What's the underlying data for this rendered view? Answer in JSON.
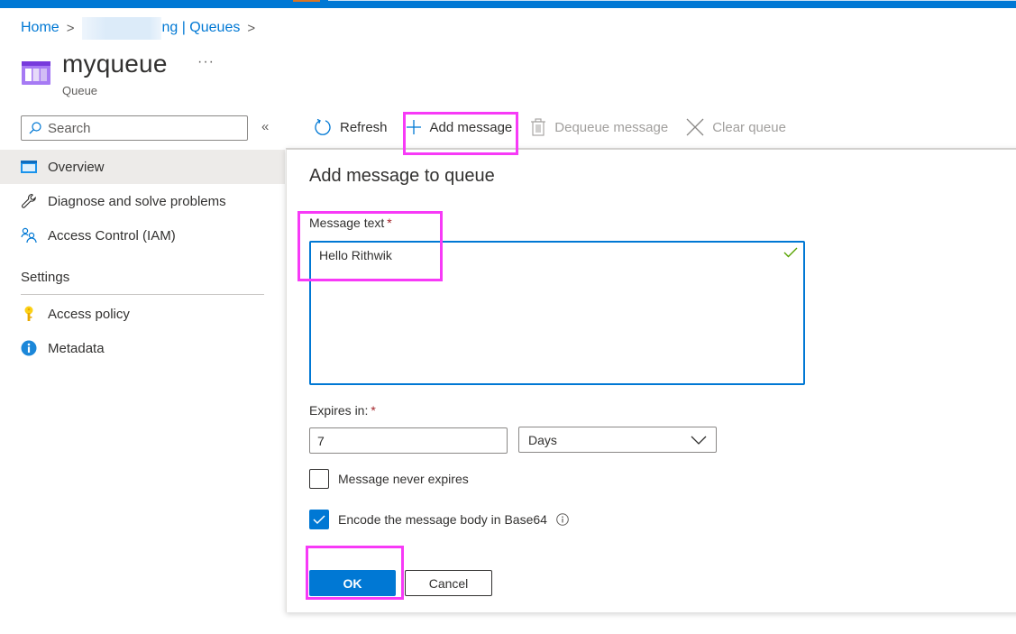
{
  "breadcrumb": {
    "items": [
      "Home",
      "ng | Queues"
    ],
    "separator": ">"
  },
  "header": {
    "title": "myqueue",
    "subtitle": "Queue",
    "more_label": "···",
    "icon": "queue-icon"
  },
  "sidebar": {
    "search_placeholder": "Search",
    "collapse_label": "«",
    "items": [
      {
        "label": "Overview",
        "icon": "overview-icon",
        "active": true
      },
      {
        "label": "Diagnose and solve problems",
        "icon": "wrench-icon",
        "active": false
      },
      {
        "label": "Access Control (IAM)",
        "icon": "people-icon",
        "active": false
      }
    ],
    "sections": [
      {
        "title": "Settings",
        "items": [
          {
            "label": "Access policy",
            "icon": "key-icon"
          },
          {
            "label": "Metadata",
            "icon": "info-icon"
          }
        ]
      }
    ]
  },
  "toolbar": {
    "refresh_label": "Refresh",
    "add_message_label": "Add message",
    "dequeue_label": "Dequeue message",
    "clear_label": "Clear queue"
  },
  "panel": {
    "title": "Add message to queue",
    "message_label": "Message text",
    "message_value": "Hello Rithwik",
    "required_mark": "*",
    "expires_label": "Expires in:",
    "expires_value": "7",
    "expires_unit": "Days",
    "never_expires_label": "Message never expires",
    "never_expires_checked": false,
    "encode_label": "Encode the message body in Base64",
    "encode_checked": true,
    "ok_label": "OK",
    "cancel_label": "Cancel"
  },
  "colors": {
    "accent": "#0078d4",
    "highlight": "#f73af7",
    "required": "#a4262c",
    "valid": "#57a300"
  }
}
